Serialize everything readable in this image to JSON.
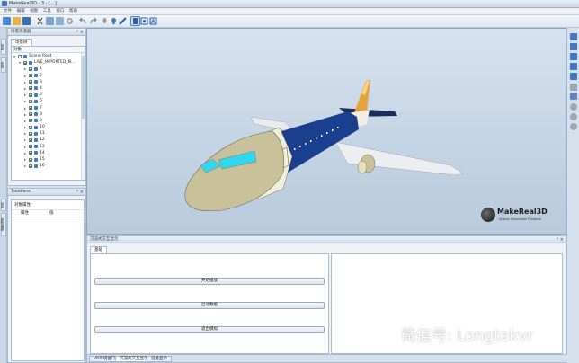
{
  "window": {
    "title": "MakeReal3D - 3 - [...]"
  },
  "menu": {
    "items": [
      "文件",
      "编辑",
      "视图",
      "工具",
      "窗口",
      "帮助"
    ]
  },
  "toolbar": {
    "icons": [
      "new-icon",
      "open-icon",
      "save-icon",
      "cut-icon",
      "copy-icon",
      "paste-icon",
      "delete-icon",
      "undo-icon",
      "redo-icon",
      "pin-icon",
      "bulb-icon",
      "pencil-icon",
      "view-a-icon",
      "view-b-icon",
      "view-c-icon"
    ]
  },
  "left_dock": {
    "side_tabs": [
      "场景",
      "资源"
    ],
    "scene_panel": {
      "title": "场景资源器",
      "ctrl": "ᵖ ×",
      "tab": "场景树",
      "column_header": "对象",
      "tree": [
        {
          "label": "Scene Root",
          "level": 0,
          "checked": false
        },
        {
          "label": "LIVE_IMPORTED_N...",
          "level": 1,
          "checked": true
        },
        {
          "label": "1",
          "level": 2,
          "checked": true
        },
        {
          "label": "2",
          "level": 2,
          "checked": true
        },
        {
          "label": "3",
          "level": 2,
          "checked": true
        },
        {
          "label": "4",
          "level": 2,
          "checked": true
        },
        {
          "label": "5",
          "level": 2,
          "checked": true
        },
        {
          "label": "6",
          "level": 2,
          "checked": true
        },
        {
          "label": "7",
          "level": 2,
          "checked": true
        },
        {
          "label": "8",
          "level": 2,
          "checked": true
        },
        {
          "label": "9",
          "level": 2,
          "checked": true
        },
        {
          "label": "10",
          "level": 2,
          "checked": true
        },
        {
          "label": "11",
          "level": 2,
          "checked": true
        },
        {
          "label": "12",
          "level": 2,
          "checked": true
        },
        {
          "label": "13",
          "level": 2,
          "checked": true
        },
        {
          "label": "14",
          "level": 2,
          "checked": true
        },
        {
          "label": "15",
          "level": 2,
          "checked": true
        },
        {
          "label": "16",
          "level": 2,
          "checked": true
        }
      ]
    },
    "tools_panel": {
      "title": "ToolsPane",
      "ctrl": "ᵖ ×",
      "side_tabs": [
        "动画",
        "属性编辑"
      ],
      "sub_title": "对象属性",
      "col_name": "属性",
      "col_value": "值"
    }
  },
  "viewport": {
    "logo_name": "MakeReal3D",
    "logo_tagline": "Virtual Simulation Platform"
  },
  "right_strip": {
    "icons": [
      "cube-front-icon",
      "cube-top-icon",
      "cube-side-icon",
      "cube-iso-icon",
      "cube-back-icon",
      "grid-icon",
      "nav-down-icon",
      "globe-icon",
      "compass-icon",
      "zoom-icon"
    ]
  },
  "bottom_panel": {
    "title": "沉浸式交互显示",
    "ctrl": "ᵖ ×",
    "tab": "基础",
    "buttons": [
      "开始播放",
      "启动数据",
      "退出模拟"
    ],
    "bottom_tabs": [
      "VR环境窗口",
      "沉浸式交互显示",
      "设备显示"
    ]
  },
  "watermark": {
    "text": "微信号: Longtekvr"
  },
  "colors": {
    "fuselage": "#1a3f8f",
    "nose": "#c9c19a",
    "cockpit": "#33d6ef",
    "tail": "#e8a23a",
    "accent": "#3f78c4"
  }
}
